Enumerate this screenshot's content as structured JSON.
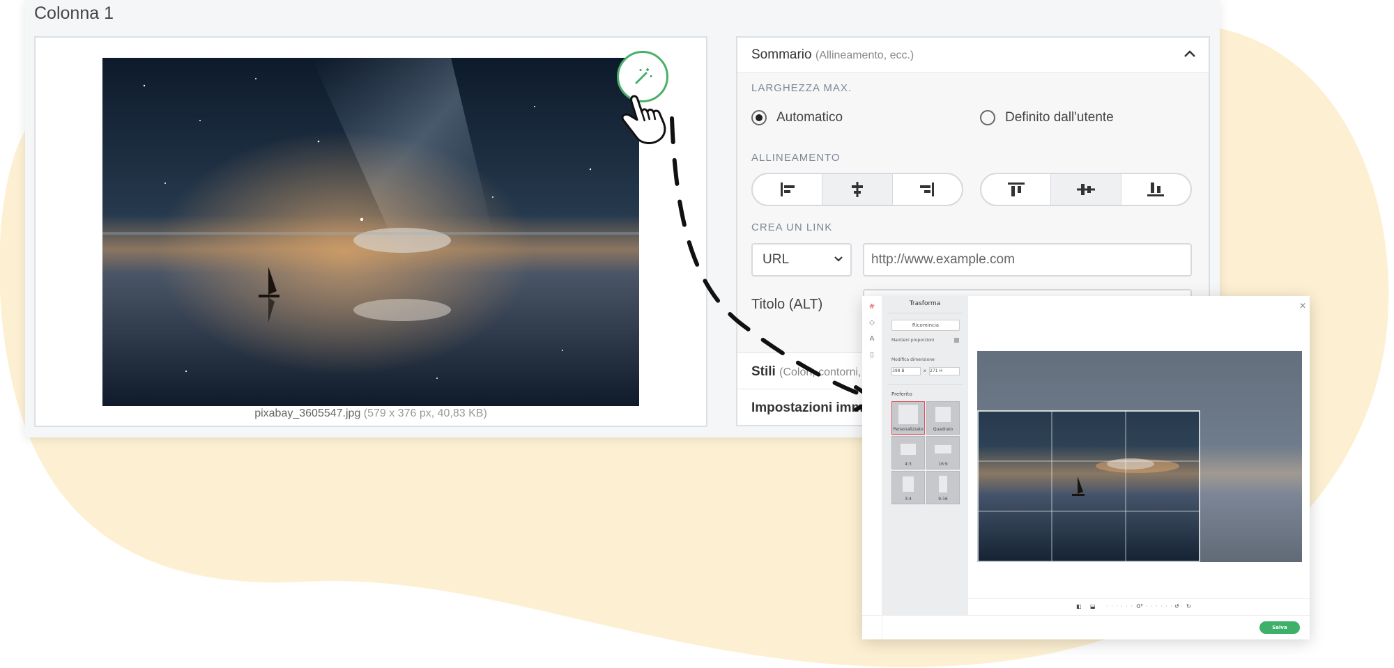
{
  "column_title": "Colonna 1",
  "image": {
    "filename": "pixabay_3605547.jpg",
    "meta": "(579 x 376 px, 40,83 KB)"
  },
  "summary": {
    "title": "Sommario",
    "subtitle": "(Allineamento, ecc.)",
    "max_width_label": "LARGHEZZA MAX.",
    "radio_auto": "Automatico",
    "radio_user": "Definito dall'utente",
    "alignment_label": "ALLINEAMENTO",
    "link_label": "CREA UN LINK",
    "link_type": "URL",
    "url_placeholder": "http://www.example.com",
    "alt_label": "Titolo (ALT)"
  },
  "sections": {
    "styles_title": "Stili",
    "styles_sub": "(Colori, contorni, ecc.)",
    "image_settings": "Impostazioni immagine"
  },
  "editor": {
    "panel_title": "Trasforma",
    "reset": "Ricomincia",
    "keep_ratio": "Mantieni proporzioni",
    "resize": "Modifica dimensione",
    "width_value": "398",
    "width_unit": "B",
    "times": "x",
    "height_value": "271",
    "height_unit": "H",
    "preferred": "Preferito",
    "ratios": [
      "Personalizzato",
      "Quadrato",
      "4:3",
      "16:9",
      "3:4",
      "9:16"
    ],
    "rotation": "0°",
    "save": "Salva"
  },
  "colors": {
    "accent_green": "#48b06a",
    "blob": "#fdf0d2",
    "selected_ratio": "#e0505a"
  },
  "icons": [
    "magic-wand-icon",
    "chevron-up-icon",
    "align-left-icon",
    "align-center-icon",
    "align-right-icon",
    "align-top-icon",
    "align-middle-icon",
    "align-bottom-icon",
    "chevron-down-icon",
    "crop-icon",
    "drop-icon",
    "text-icon",
    "bookmark-icon",
    "close-icon",
    "flip-horizontal-icon",
    "flip-vertical-icon",
    "rotate-left-icon",
    "rotate-right-icon",
    "pointer-hand-icon",
    "dashed-arrow-icon"
  ]
}
